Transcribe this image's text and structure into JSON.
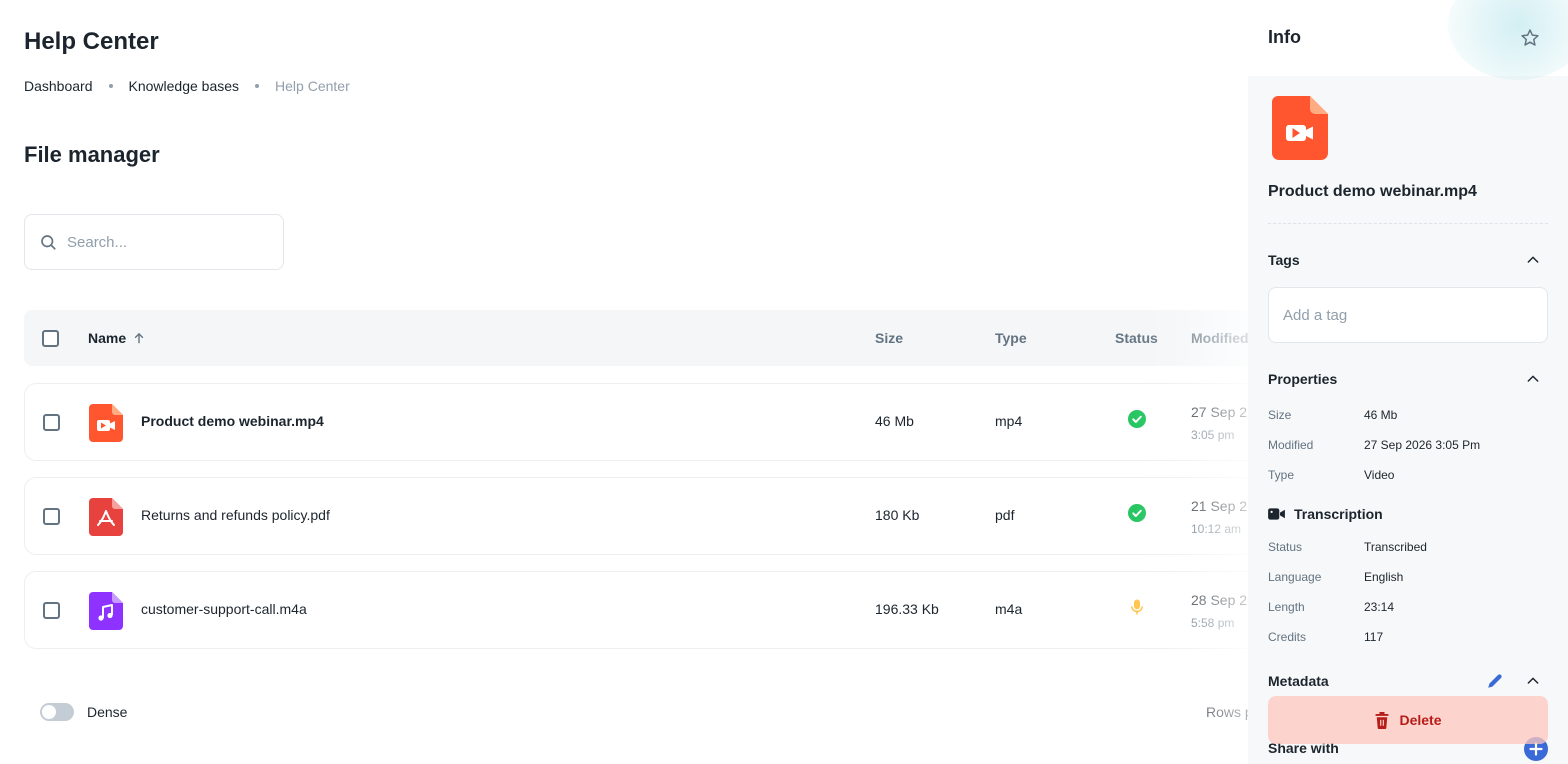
{
  "page": {
    "title": "Help Center",
    "breadcrumb": [
      "Dashboard",
      "Knowledge bases",
      "Help Center"
    ],
    "section_title": "File manager"
  },
  "search": {
    "placeholder": "Search...",
    "icon": "search-icon"
  },
  "table": {
    "columns": {
      "name": "Name",
      "size": "Size",
      "type": "Type",
      "status": "Status",
      "modified": "Modified"
    },
    "rows": [
      {
        "name": "Product demo webinar.mp4",
        "size": "46 Mb",
        "type": "mp4",
        "status": "done",
        "date": "27 Sep 2",
        "time": "3:05 pm",
        "icon": "video-file-icon"
      },
      {
        "name": "Returns and refunds policy.pdf",
        "size": "180 Kb",
        "type": "pdf",
        "status": "done",
        "date": "21 Sep 2",
        "time": "10:12 am",
        "icon": "pdf-file-icon"
      },
      {
        "name": "customer-support-call.m4a",
        "size": "196.33 Kb",
        "type": "m4a",
        "status": "processing",
        "date": "28 Sep 2",
        "time": "5:58 pm",
        "icon": "audio-file-icon"
      }
    ]
  },
  "footer": {
    "dense_label": "Dense",
    "rows_per_page": "Rows p"
  },
  "drawer": {
    "title": "Info",
    "file_name": "Product demo webinar.mp4",
    "tags": {
      "title": "Tags",
      "placeholder": "Add a tag"
    },
    "properties": {
      "title": "Properties",
      "items": [
        {
          "label": "Size",
          "value": "46 Mb"
        },
        {
          "label": "Modified",
          "value": "27 Sep 2026 3:05 Pm"
        },
        {
          "label": "Type",
          "value": "Video"
        }
      ]
    },
    "transcription": {
      "title": "Transcription",
      "items": [
        {
          "label": "Status",
          "value": "Transcribed"
        },
        {
          "label": "Language",
          "value": "English"
        },
        {
          "label": "Length",
          "value": "23:14"
        },
        {
          "label": "Credits",
          "value": "117"
        }
      ]
    },
    "metadata": {
      "title": "Metadata"
    },
    "delete_label": "Delete",
    "share_title": "Share with"
  },
  "colors": {
    "video": "#ff5630",
    "pdf": "#e8423f",
    "audio": "#8e33ff",
    "success": "#22c55e",
    "warning": "#ffab00",
    "primary": "#3a6ad6"
  }
}
